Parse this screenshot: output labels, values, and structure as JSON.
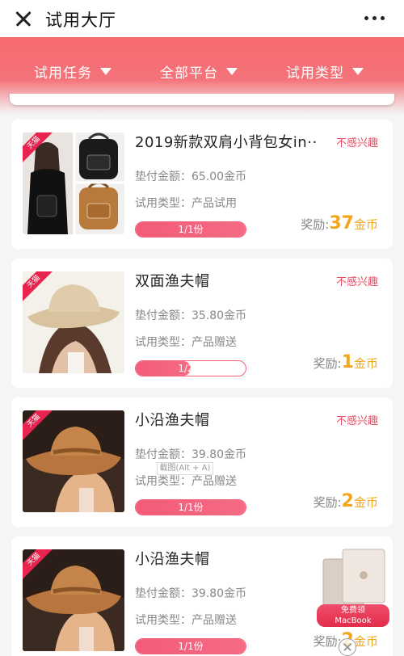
{
  "header": {
    "title": "试用大厅"
  },
  "filters": [
    "试用任务",
    "全部平台",
    "试用类型"
  ],
  "labels": {
    "not_interested": "不感兴趣",
    "pay_prefix": "垫付金额：",
    "type_prefix": "试用类型：",
    "reward_prefix": "奖励:",
    "reward_unit": "金币",
    "tmall_tag": "天猫"
  },
  "products": [
    {
      "title": "2019新款双肩小背包女in··",
      "pay": "65.00金币",
      "type": "产品试用",
      "progress_text": "1/1份",
      "progress": 1.0,
      "reward": "37"
    },
    {
      "title": "双面渔夫帽",
      "pay": "35.80金币",
      "type": "产品赠送",
      "progress_text": "1/2份",
      "progress": 0.5,
      "reward": "1"
    },
    {
      "title": "小沿渔夫帽",
      "pay": "39.80金币",
      "type": "产品赠送",
      "progress_text": "1/1份",
      "progress": 1.0,
      "reward": "2"
    },
    {
      "title": "小沿渔夫帽",
      "pay": "39.80金币",
      "type": "产品赠送",
      "progress_text": "1/1份",
      "progress": 1.0,
      "reward": "2"
    }
  ],
  "tooltip": "截图(Alt + A)",
  "promo": {
    "line1": "免费领",
    "line2": "MacBook"
  },
  "colors": {
    "accent": "#f4646e",
    "gold": "#f3a51c",
    "tag": "#e8244e"
  }
}
